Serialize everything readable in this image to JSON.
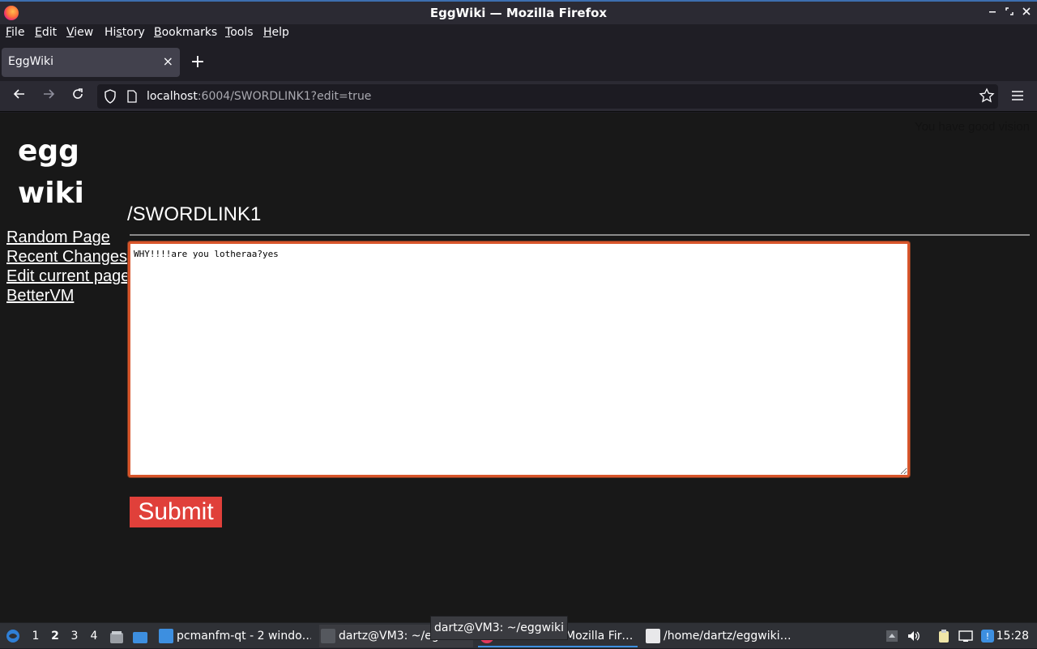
{
  "window": {
    "title": "EggWiki — Mozilla Firefox"
  },
  "menu": [
    "File",
    "Edit",
    "View",
    "History",
    "Bookmarks",
    "Tools",
    "Help"
  ],
  "menu_mnemonics": [
    "F",
    "E",
    "V",
    "s",
    "B",
    "T",
    "H"
  ],
  "tab": {
    "title": "EggWiki",
    "close": "×"
  },
  "newtab": "+",
  "url": {
    "host": "localhost",
    "rest": ":6004/SWORDLINK1?edit=true"
  },
  "page": {
    "hidden_message": "You have good vision",
    "logo_line1": "egg",
    "logo_line2": "wiki",
    "nav": [
      "Random Page",
      "Recent Changes",
      "Edit current page",
      "BetterVM"
    ],
    "heading": "/SWORDLINK1",
    "editor_text": "WHY!!!!are you lotheraa?yes",
    "submit_label": "Submit"
  },
  "taskbar": {
    "workspaces": [
      "1",
      "2",
      "3",
      "4"
    ],
    "active_workspace": "2",
    "tasks": [
      {
        "label": "pcmanfm-qt - 2 windo…",
        "icon": "folder-icon"
      },
      {
        "label": "dartz@VM3: ~/eg…",
        "icon": "terminal-icon"
      },
      {
        "label": "Mozilla Fir…",
        "icon": "firefox-icon"
      },
      {
        "label": "/home/dartz/eggwiki…",
        "icon": "text-editor-icon"
      }
    ],
    "tooltip": "dartz@VM3: ~/eggwiki",
    "clock": "15:28"
  },
  "colors": {
    "accent": "#3d8fe0",
    "submit": "#e0403a",
    "editor_border": "#d8552b"
  }
}
